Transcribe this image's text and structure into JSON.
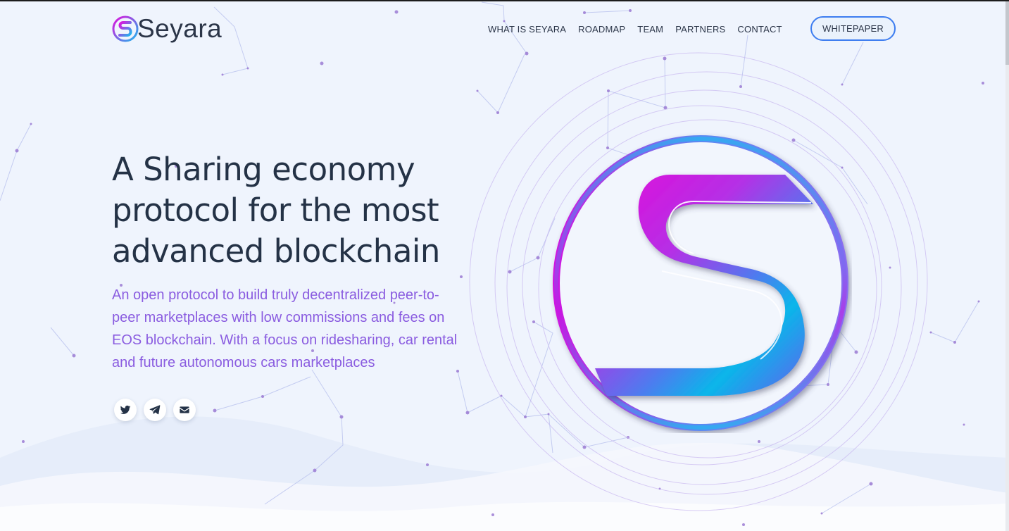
{
  "brand": {
    "name": "Seyara"
  },
  "nav": {
    "items": [
      {
        "label": "WHAT IS SEYARA"
      },
      {
        "label": "ROADMAP"
      },
      {
        "label": "TEAM"
      },
      {
        "label": "PARTNERS"
      },
      {
        "label": "CONTACT"
      }
    ],
    "whitepaper_label": "WHITEPAPER"
  },
  "hero": {
    "title_lines": [
      "A Sharing economy",
      "protocol for the most",
      "advanced blockchain"
    ],
    "subtitle_lines": [
      "An open protocol to build truly decentralized peer-to-",
      "peer marketplaces with low commissions and fees on",
      "EOS blockchain. With a focus on ridesharing, car rental",
      "and future autonomous cars marketplaces"
    ]
  },
  "social": [
    {
      "icon": "twitter-icon"
    },
    {
      "icon": "telegram-icon"
    },
    {
      "icon": "email-icon"
    }
  ],
  "colors": {
    "text_dark": "#243246",
    "subtitle_purple": "#8a5ce0",
    "accent_blue": "#3d7df0",
    "accent_magenta": "#e20fdc",
    "accent_cyan": "#11b9ec",
    "background": "#eff4fd"
  }
}
